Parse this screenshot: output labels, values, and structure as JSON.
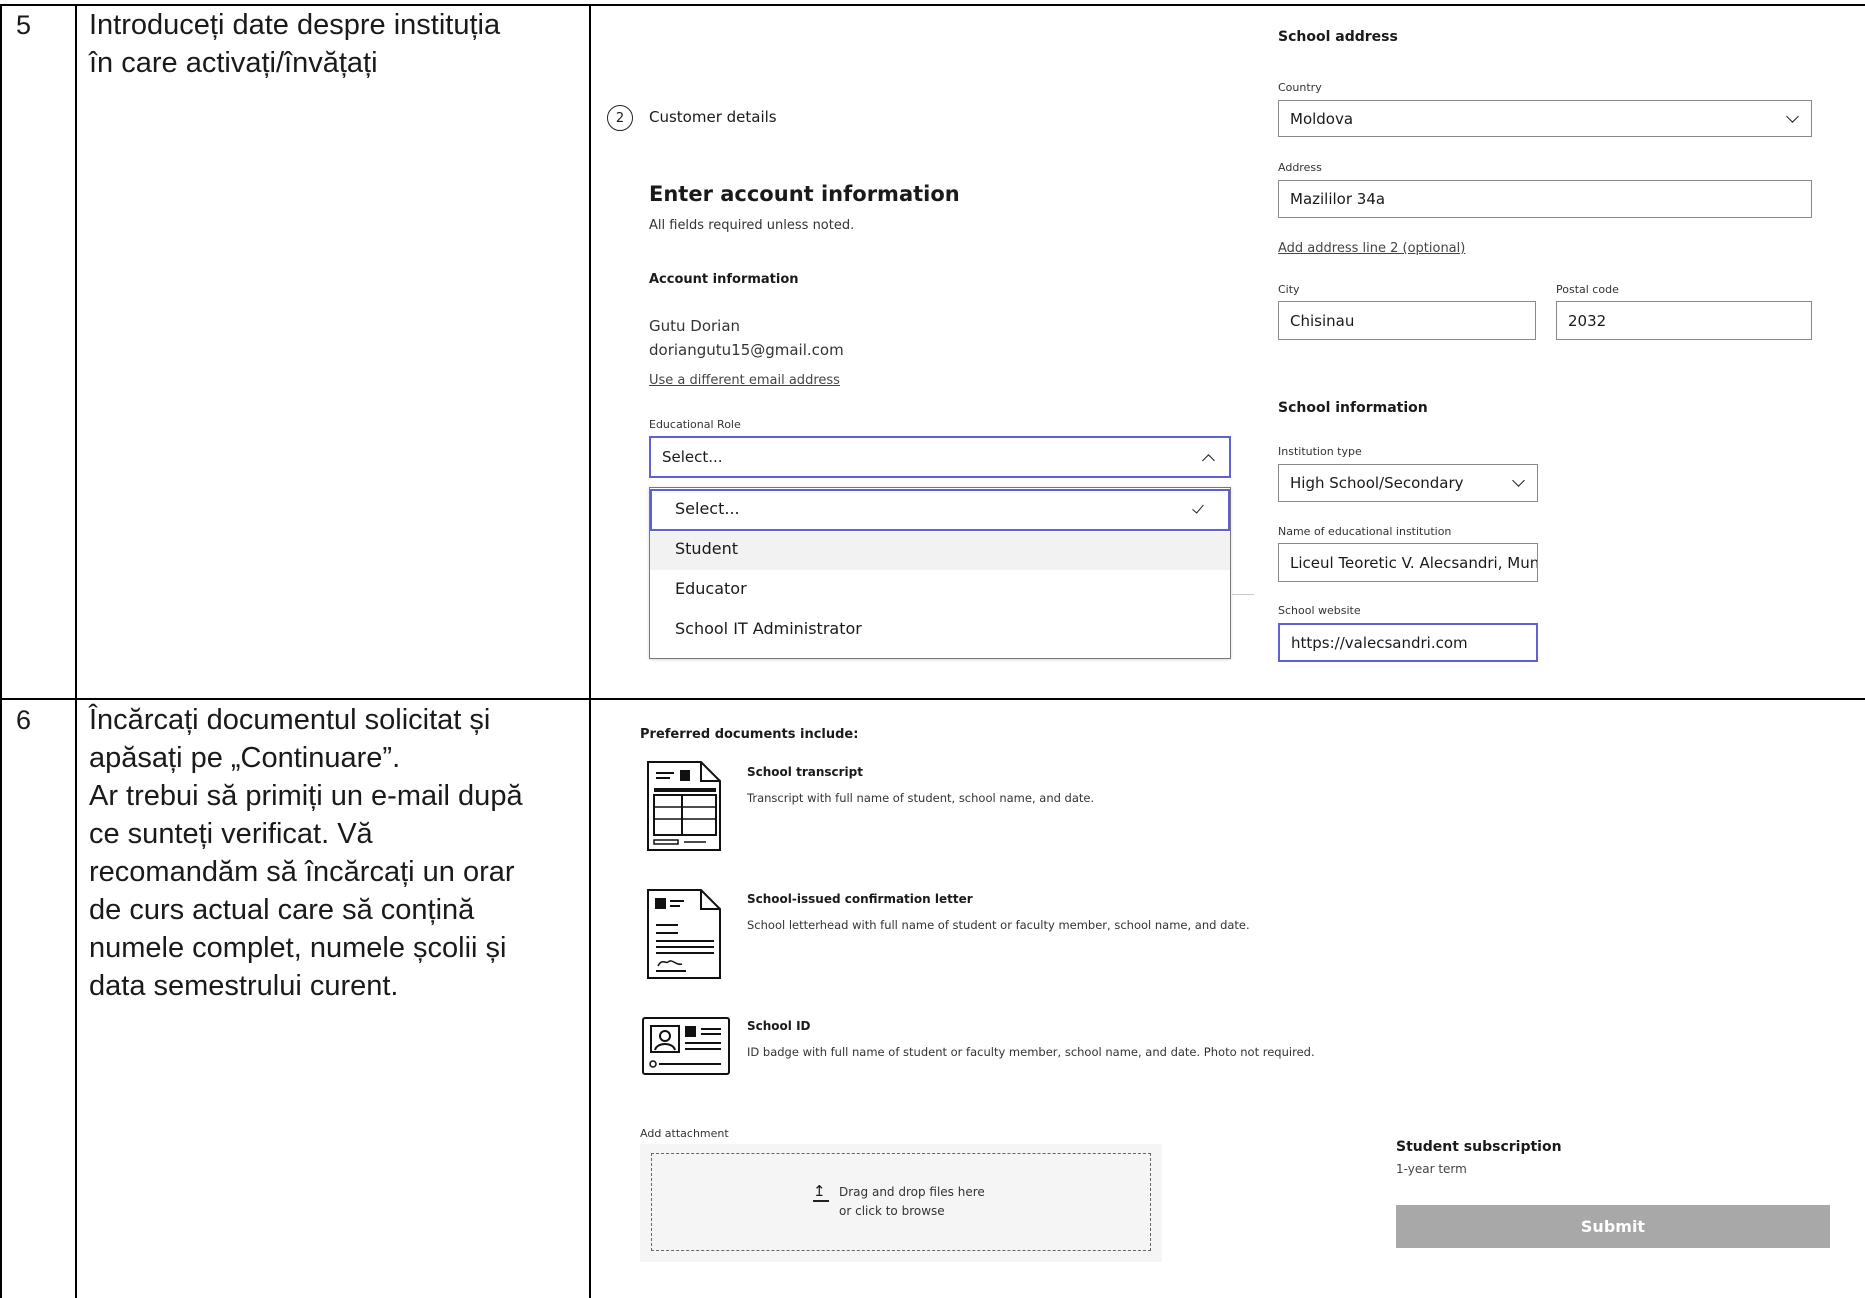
{
  "rows": [
    {
      "num": "5",
      "instruction_lines": [
        "Introduceți date despre instituția",
        "în care activați/învățați"
      ]
    },
    {
      "num": "6",
      "instruction_lines": [
        "Încărcați documentul solicitat și",
        "apăsați pe „Continuare”.",
        "Ar trebui să primiți un e-mail după",
        "ce sunteți verificat. Vă",
        "recomandăm să încărcați un orar",
        "de curs actual care să conțină",
        "numele complet, numele școlii și",
        "data semestrului curent."
      ]
    }
  ],
  "form": {
    "step_number": "2",
    "step_label": "Customer details",
    "title": "Enter account information",
    "subtitle": "All fields required unless noted.",
    "account_heading": "Account information",
    "name": "Gutu Dorian",
    "email": "doriangutu15@gmail.com",
    "change_email_link": "Use a different email address",
    "role_label": "Educational Role",
    "role_value": "Select...",
    "role_options": [
      "Select...",
      "Student",
      "Educator",
      "School IT Administrator"
    ],
    "address_heading": "School address",
    "country_label": "Country",
    "country_value": "Moldova",
    "address_label": "Address",
    "address_value": "Mazililor 34a",
    "address2_link": "Add address line 2 (optional)",
    "city_label": "City",
    "city_value": "Chisinau",
    "postal_label": "Postal code",
    "postal_value": "2032",
    "school_info_heading": "School information",
    "inst_type_label": "Institution type",
    "inst_type_value": "High School/Secondary",
    "inst_name_label": "Name of educational institution",
    "inst_name_value": "Liceul Teoretic V. Alecsandri, Mun",
    "website_label": "School website",
    "website_value": "https://valecsandri.com"
  },
  "upload": {
    "heading": "Preferred documents include:",
    "docs": [
      {
        "title": "School transcript",
        "desc": "Transcript with full name of student, school name, and date.",
        "icon": "transcript-icon"
      },
      {
        "title": "School-issued confirmation letter",
        "desc": "School letterhead with full name of student or faculty member, school name, and date.",
        "icon": "letter-icon"
      },
      {
        "title": "School ID",
        "desc": "ID badge with full name of student or faculty member, school name, and date. Photo not required.",
        "icon": "id-card-icon"
      }
    ],
    "attach_label": "Add attachment",
    "drop_line1": "Drag and drop files here",
    "drop_line2": "or click to browse",
    "sub_title": "Student subscription",
    "sub_term": "1-year term",
    "submit_label": "Submit"
  },
  "colors": {
    "focus_border": "#5f60d6",
    "submit_bg": "#a8a8a8",
    "hover_row": "#f2f2f2"
  }
}
